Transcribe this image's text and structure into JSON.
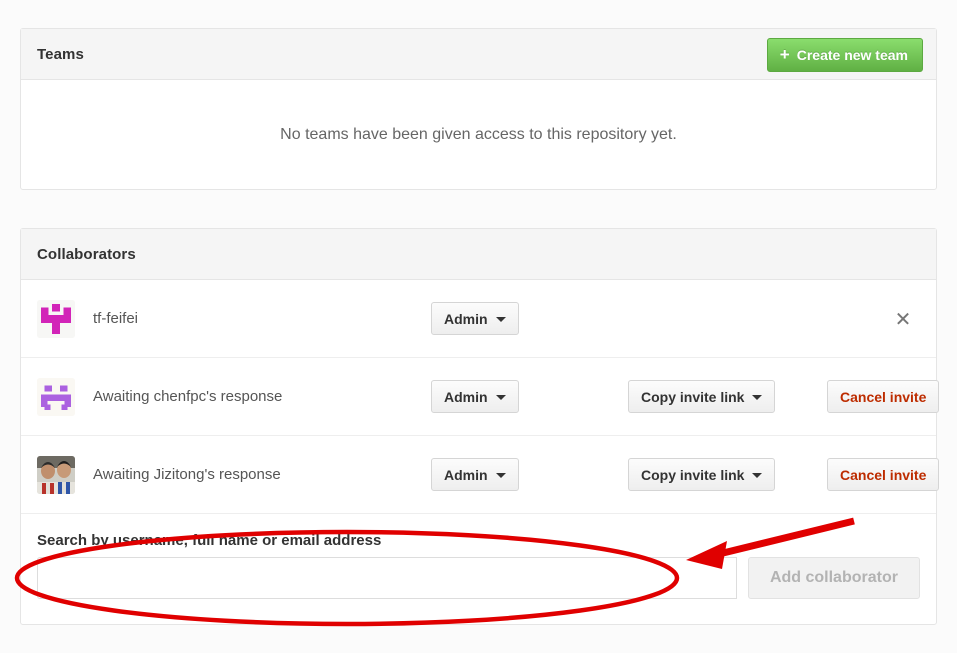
{
  "theme": {
    "page_background": "#fbfbfb",
    "panel_background": "#ffffff",
    "header_background": "#f5f5f5",
    "border": "#e5e5e5",
    "green_button": "#60b044",
    "danger_text": "#bd2c00",
    "annotation_red": "#e00000",
    "muted_text": "#666666"
  },
  "teams": {
    "title": "Teams",
    "create_button": {
      "label": "Create new team",
      "icon": "plus-icon"
    },
    "empty_message": "No teams have been given access to this repository yet."
  },
  "collaborators": {
    "title": "Collaborators",
    "rows": [
      {
        "name": "tf-feifei",
        "avatar": "identicon-magenta",
        "role": "Admin",
        "role_caret": "chevron-down-icon",
        "has_invite_link": false,
        "has_cancel": false,
        "has_remove": true,
        "remove_icon": "close-icon"
      },
      {
        "name": "Awaiting chenfpc's response",
        "avatar": "identicon-purple",
        "role": "Admin",
        "role_caret": "chevron-down-icon",
        "has_invite_link": true,
        "invite_link_label": "Copy invite link",
        "invite_link_caret": "chevron-down-icon",
        "has_cancel": true,
        "cancel_label": "Cancel invite",
        "has_remove": false
      },
      {
        "name": "Awaiting Jizitong's response",
        "avatar": "photo-two-people",
        "role": "Admin",
        "role_caret": "chevron-down-icon",
        "has_invite_link": true,
        "invite_link_label": "Copy invite link",
        "invite_link_caret": "chevron-down-icon",
        "has_cancel": true,
        "cancel_label": "Cancel invite",
        "has_remove": false
      }
    ],
    "add_form": {
      "label": "Search by username, full name or email address",
      "input_value": "",
      "input_placeholder": "",
      "submit_label": "Add collaborator",
      "submit_disabled": true
    }
  },
  "annotations": [
    {
      "type": "ellipse",
      "name": "highlight-ellipse-search-field",
      "color": "#e00000"
    },
    {
      "type": "arrow",
      "name": "pointer-arrow-search-field",
      "color": "#e00000"
    }
  ]
}
